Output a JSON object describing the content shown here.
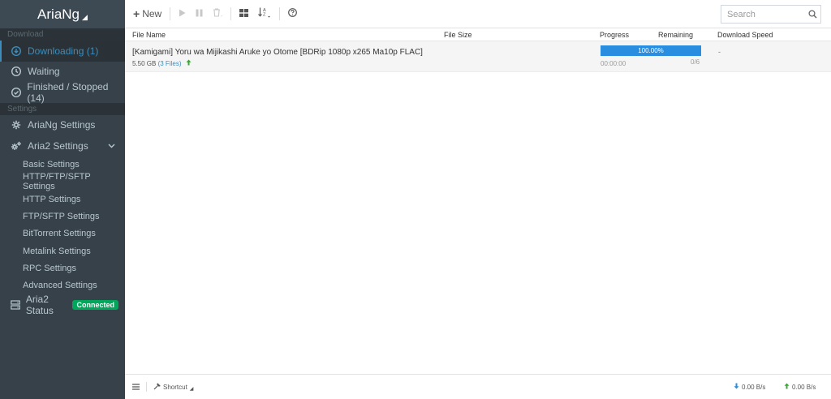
{
  "brand": {
    "title": "AriaNg"
  },
  "sidebar": {
    "download_header": "Download",
    "download_items": [
      {
        "label": "Downloading (1)",
        "icon": "arrow-circle-down-icon",
        "active": true
      },
      {
        "label": "Waiting",
        "icon": "clock-icon"
      },
      {
        "label": "Finished / Stopped (14)",
        "icon": "check-circle-icon"
      }
    ],
    "settings_header": "Settings",
    "ariang_settings": "AriaNg Settings",
    "aria2_settings": "Aria2 Settings",
    "aria2_sub": [
      "Basic Settings",
      "HTTP/FTP/SFTP Settings",
      "HTTP Settings",
      "FTP/SFTP Settings",
      "BitTorrent Settings",
      "Metalink Settings",
      "RPC Settings",
      "Advanced Settings"
    ],
    "aria2_status": "Aria2 Status",
    "status_badge": "Connected"
  },
  "toolbar": {
    "new_label": "New",
    "search_placeholder": "Search"
  },
  "table": {
    "headers": {
      "file_name": "File Name",
      "file_size": "File Size",
      "progress": "Progress",
      "remaining": "Remaining",
      "speed": "Download Speed"
    },
    "rows": [
      {
        "name": "[Kamigami] Yoru wa Mijikashi Aruke yo Otome [BDRip 1080p x265 Ma10p FLAC]",
        "size": "5.50 GB",
        "files": "(3 Files)",
        "progress_pct": 100,
        "progress_text": "100.00%",
        "remaining_time": "00:00:00",
        "pieces": "0/6",
        "speed": "-"
      }
    ]
  },
  "footer": {
    "shortcut": "Shortcut",
    "download_speed": "0.00 B/s",
    "upload_speed": "0.00 B/s"
  },
  "colors": {
    "sidebar_bg": "#374149",
    "accent": "#3c8dbc",
    "progress": "#2a8ee0",
    "connected": "#00a65a",
    "upload": "#3fa33b"
  }
}
